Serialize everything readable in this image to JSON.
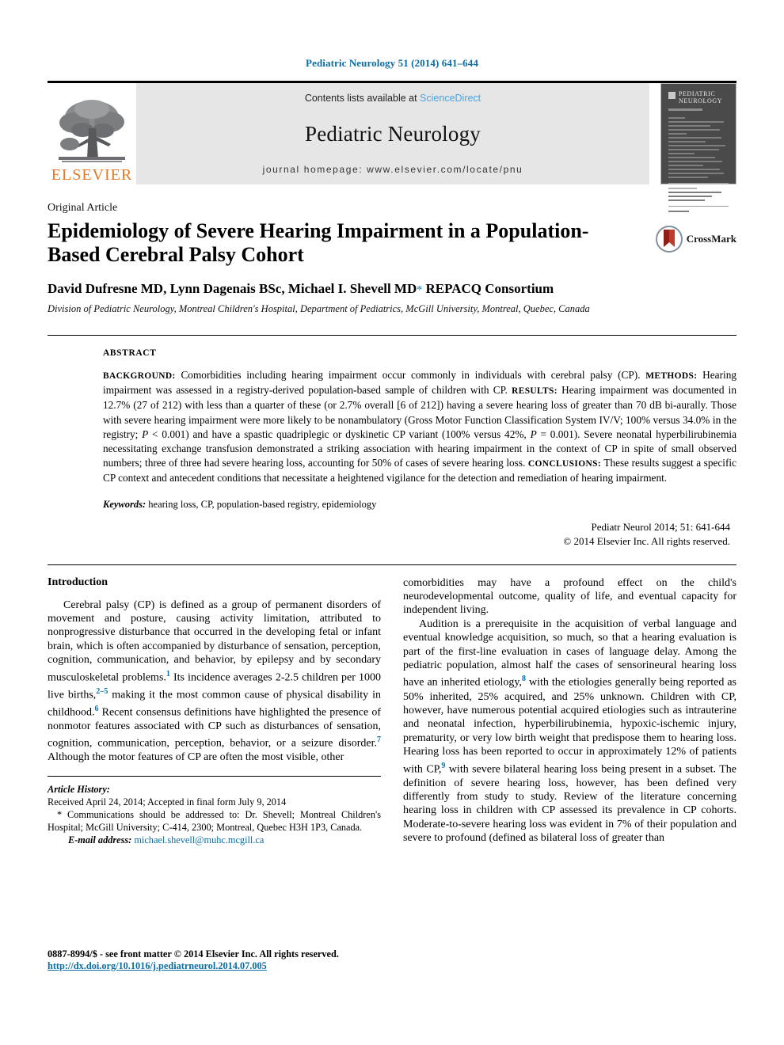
{
  "running_head": "Pediatric Neurology 51 (2014) 641–644",
  "masthead": {
    "elsevier_wordmark": "ELSEVIER",
    "contents_prefix": "Contents lists available at ",
    "sciencedirect": "ScienceDirect",
    "journal_title": "Pediatric Neurology",
    "homepage": "journal homepage: www.elsevier.com/locate/pnu",
    "cover_title": "PEDIATRIC\nNEUROLOGY"
  },
  "article": {
    "type": "Original Article",
    "title": "Epidemiology of Severe Hearing Impairment in a Population-Based Cerebral Palsy Cohort",
    "authors": "David Dufresne MD, Lynn Dagenais BSc, Michael I. Shevell MD",
    "author_marker": "*",
    "consortium": "REPACQ Consortium",
    "affiliation": "Division of Pediatric Neurology, Montreal Children's Hospital, Department of Pediatrics, McGill University, Montreal, Quebec, Canada",
    "crossmark_label": "CrossMark"
  },
  "abstract": {
    "heading": "ABSTRACT",
    "labels": {
      "background": "BACKGROUND:",
      "methods": "METHODS:",
      "results": "RESULTS:",
      "conclusions": "CONCLUSIONS:"
    },
    "background_text": " Comorbidities including hearing impairment occur commonly in individuals with cerebral palsy (CP). ",
    "methods_text": " Hearing impairment was assessed in a registry-derived population-based sample of children with CP. ",
    "results_text_a": " Hearing impairment was documented in 12.7% (27 of 212) with less than a quarter of these (or 2.7% overall [6 of 212]) having a severe hearing loss of greater than 70 dB bi-aurally. Those with severe hearing impairment were more likely to be nonambulatory (Gross Motor Function Classification System IV/V; 100% versus 34.0% in the registry; ",
    "results_p1": "P",
    "results_text_b": " < 0.001) and have a spastic quadriplegic or dyskinetic CP variant (100% versus 42%, ",
    "results_p2": "P",
    "results_text_c": " = 0.001). Severe neonatal hyperbilirubinemia necessitating exchange transfusion demonstrated a striking association with hearing impairment in the context of CP in spite of small observed numbers; three of three had severe hearing loss, accounting for 50% of cases of severe hearing loss. ",
    "conclusions_text": " These results suggest a specific CP context and antecedent conditions that necessitate a heightened vigilance for the detection and remediation of hearing impairment.",
    "keywords_label": "Keywords:",
    "keywords_value": " hearing loss, CP, population-based registry, epidemiology",
    "citation": "Pediatr Neurol 2014; 51: 641-644",
    "copyright": "© 2014 Elsevier Inc. All rights reserved."
  },
  "body": {
    "intro_heading": "Introduction",
    "left_p1_a": "Cerebral palsy (CP) is defined as a group of permanent disorders of movement and posture, causing activity limitation, attributed to nonprogressive disturbance that occurred in the developing fetal or infant brain, which is often accompanied by disturbance of sensation, perception, cognition, communication, and behavior, by epilepsy and by secondary musculoskeletal problems.",
    "ref1": "1",
    "left_p1_b": " Its incidence averages 2-2.5 children per 1000 live births,",
    "ref2": "2–5",
    "left_p1_c": " making it the most common cause of physical disability in childhood.",
    "ref3": "6",
    "left_p1_d": " Recent consensus definitions have highlighted the presence of nonmotor features associated with CP such as disturbances of sensation, cognition, communication, perception, behavior, or a seizure disorder.",
    "ref4": "7",
    "left_p1_e": " Although the motor features of CP are often the most visible, other",
    "right_p1": "comorbidities may have a profound effect on the child's neurodevelopmental outcome, quality of life, and eventual capacity for independent living.",
    "right_p2_a": "Audition is a prerequisite in the acquisition of verbal language and eventual knowledge acquisition, so much, so that a hearing evaluation is part of the first-line evaluation in cases of language delay. Among the pediatric population, almost half the cases of sensorineural hearing loss have an inherited etiology,",
    "ref5": "8",
    "right_p2_b": " with the etiologies generally being reported as 50% inherited, 25% acquired, and 25% unknown. Children with CP, however, have numerous potential acquired etiologies such as intrauterine and neonatal infection, hyperbilirubinemia, hypoxic-ischemic injury, prematurity, or very low birth weight that predispose them to hearing loss. Hearing loss has been reported to occur in approximately 12% of patients with CP,",
    "ref6": "9",
    "right_p2_c": " with severe bilateral hearing loss being present in a subset. The definition of severe hearing loss, however, has been defined very differently from study to study. Review of the literature concerning hearing loss in children with CP assessed its prevalence in CP cohorts. Moderate-to-severe hearing loss was evident in 7% of their population and severe to profound (defined as bilateral loss of greater than"
  },
  "footnotes": {
    "history_label": "Article History:",
    "history_value": "Received April 24, 2014; Accepted in final form July 9, 2014",
    "correspondence": "* Communications should be addressed to: Dr. Shevell; Montreal Children's Hospital; McGill University; C-414, 2300; Montreal, Quebec H3H 1P3, Canada.",
    "email_label": "E-mail address:",
    "email_value": "michael.shevell@muhc.mcgill.ca"
  },
  "bottom": {
    "issn": "0887-8994/$ - see front matter © 2014 Elsevier Inc. All rights reserved.",
    "doi": "http://dx.doi.org/10.1016/j.pediatrneurol.2014.07.005"
  },
  "colors": {
    "link_blue": "#0b6da4",
    "sciencedirect_blue": "#4aa3df",
    "elsevier_orange": "#E87722",
    "band_gray": "#e6e6e6",
    "cover_gray": "#4a4a4a"
  }
}
